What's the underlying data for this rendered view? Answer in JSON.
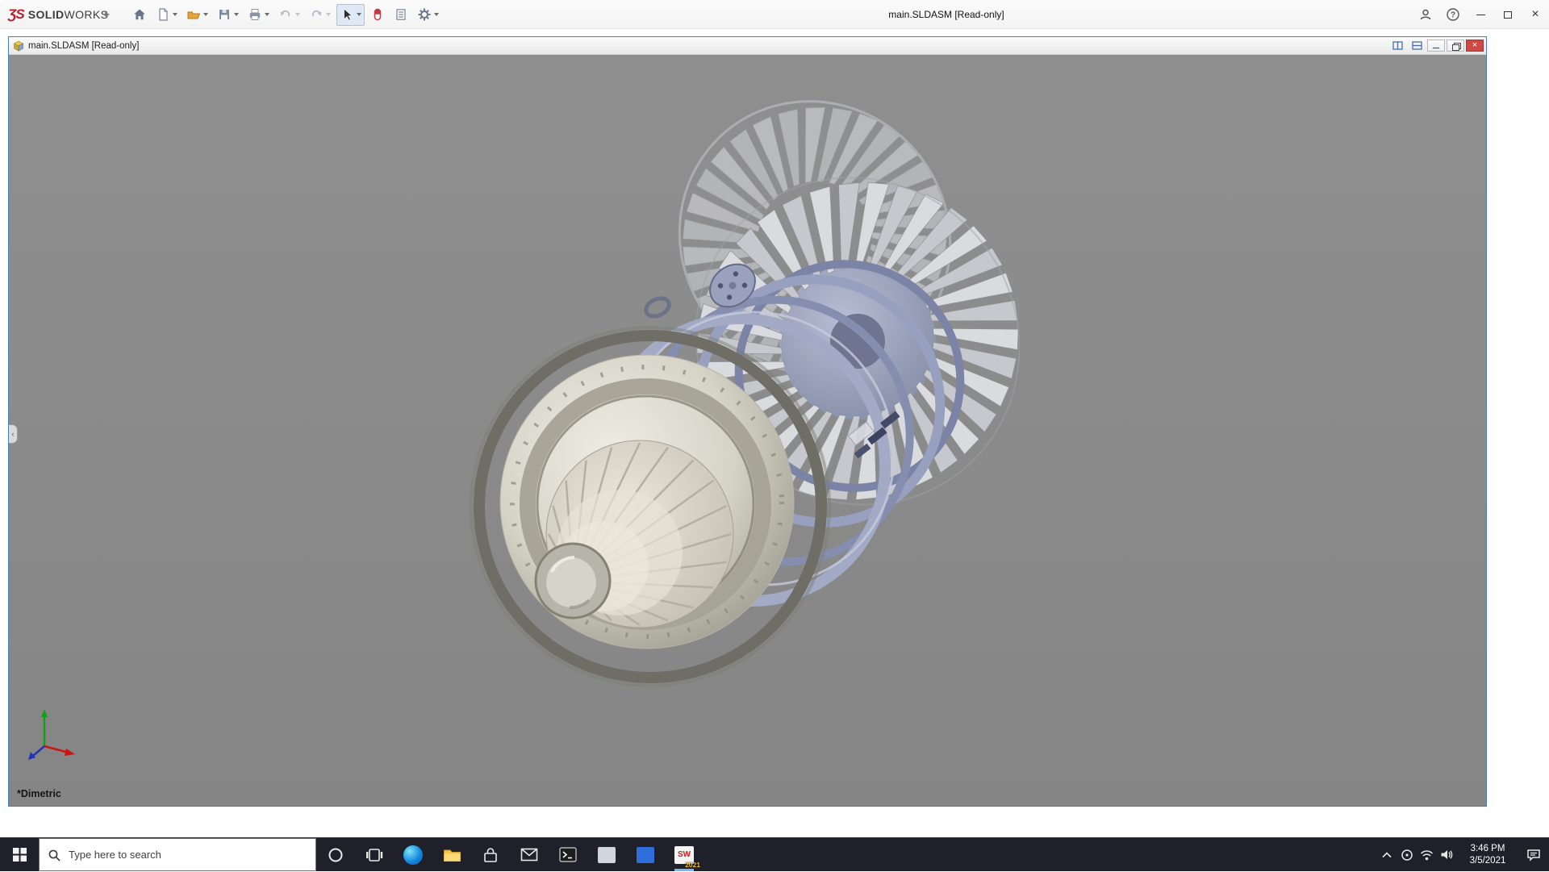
{
  "app": {
    "title": "main.SLDASM [Read-only]",
    "logo_mark": "ƷS",
    "brand_bold": "SOLID",
    "brand_light": "WORKS",
    "toolbar_items": [
      "home",
      "new-document",
      "open",
      "save",
      "print",
      "undo",
      "redo",
      "select",
      "mouse-gestures",
      "options",
      "settings"
    ]
  },
  "doc_window": {
    "title": "main.SLDASM [Read-only]"
  },
  "viewport": {
    "view_orientation": "*Dimetric"
  },
  "taskbar": {
    "search_placeholder": "Type here to search",
    "solidworks_badge": "2021",
    "clock": {
      "time": "3:46 PM",
      "date": "3/5/2021"
    }
  },
  "colors": {
    "brand_red": "#b5212d",
    "doc_border_blue": "#4a7ebb",
    "viewport_gray": "#8b8b8b",
    "taskbar_bg": "#20202a"
  }
}
